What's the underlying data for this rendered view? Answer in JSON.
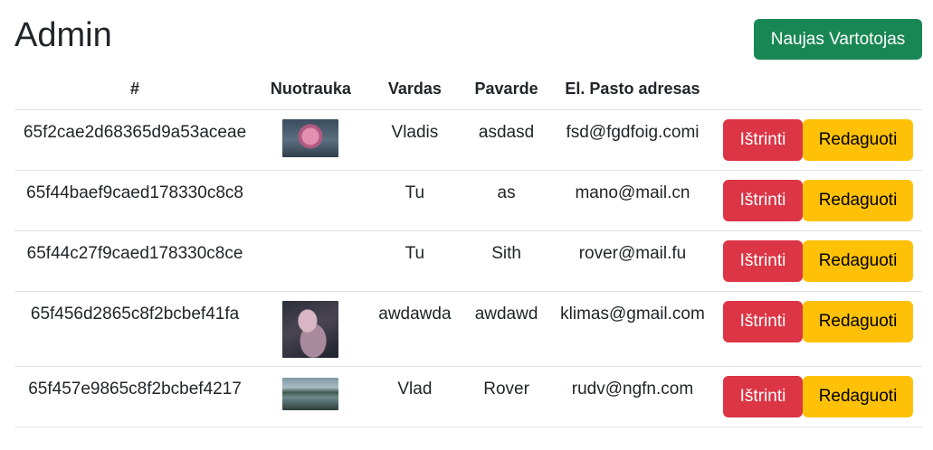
{
  "page": {
    "title": "Admin",
    "new_user_label": "Naujas Vartotojas"
  },
  "table": {
    "headers": [
      "#",
      "Nuotrauka",
      "Vardas",
      "Pavarde",
      "El. Pasto adresas",
      ""
    ],
    "rows": [
      {
        "id": "65f2cae2d68365d9a53aceae",
        "photo": "rose-photo",
        "vardas": "Vladis",
        "pavarde": "asdasd",
        "email": "fsd@fgdfoig.comi"
      },
      {
        "id": "65f44baef9caed178330c8c8",
        "photo": "",
        "vardas": "Tu",
        "pavarde": "as",
        "email": "mano@mail.cn"
      },
      {
        "id": "65f44c27f9caed178330c8ce",
        "photo": "",
        "vardas": "Tu",
        "pavarde": "Sith",
        "email": "rover@mail.fu"
      },
      {
        "id": "65f456d2865c8f2bcbef41fa",
        "photo": "octopus-photo",
        "vardas": "awdawda",
        "pavarde": "awdawd",
        "email": "klimas@gmail.com"
      },
      {
        "id": "65f457e9865c8f2bcbef4217",
        "photo": "lake-photo",
        "vardas": "Vlad",
        "pavarde": "Rover",
        "email": "rudv@ngfn.com"
      }
    ],
    "delete_label": "Ištrinti",
    "edit_label": "Redaguoti"
  },
  "colors": {
    "success": "#198754",
    "danger": "#dc3545",
    "warning": "#ffc107",
    "text": "#212529",
    "border": "#dee2e6"
  }
}
